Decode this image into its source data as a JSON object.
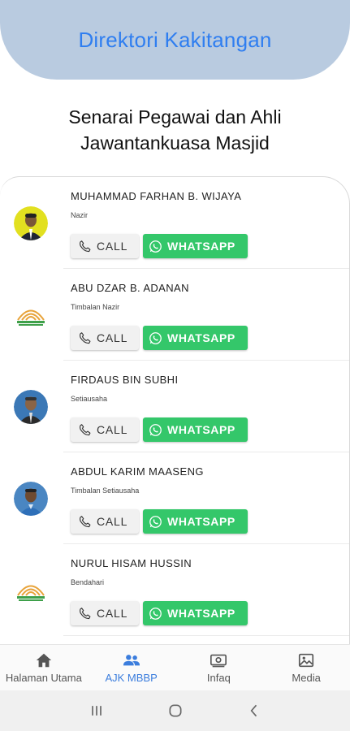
{
  "header": {
    "title": "Direktori Kakitangan"
  },
  "subtitle": {
    "line1": "Senarai Pegawai dan Ahli",
    "line2": "Jawantankuasa Masjid"
  },
  "buttons": {
    "call_label": "CALL",
    "whatsapp_label": "WHATSAPP"
  },
  "colors": {
    "header_bg": "#b9cbe0",
    "title": "#2f7ef0",
    "whatsapp": "#34c76a",
    "nav_active": "#3b7ddd"
  },
  "staff": [
    {
      "name": "MUHAMMAD FARHAN B. WIJAYA",
      "role": "Nazir",
      "avatar": "photo-yellow"
    },
    {
      "name": "ABU DZAR B. ADANAN",
      "role": "Timbalan Nazir",
      "avatar": "mosque-logo"
    },
    {
      "name": "FIRDAUS BIN SUBHI",
      "role": "Setiausaha",
      "avatar": "photo-blue"
    },
    {
      "name": "ABDUL KARIM MAASENG",
      "role": "Timbalan Setiausaha",
      "avatar": "photo-blue-shirt"
    },
    {
      "name": "NURUL HISAM HUSSIN",
      "role": "Bendahari",
      "avatar": "mosque-logo"
    }
  ],
  "bottom_nav": [
    {
      "label": "Halaman Utama",
      "icon": "home-icon",
      "active": false
    },
    {
      "label": "AJK MBBP",
      "icon": "people-icon",
      "active": true
    },
    {
      "label": "Infaq",
      "icon": "money-icon",
      "active": false
    },
    {
      "label": "Media",
      "icon": "gallery-icon",
      "active": false
    }
  ]
}
